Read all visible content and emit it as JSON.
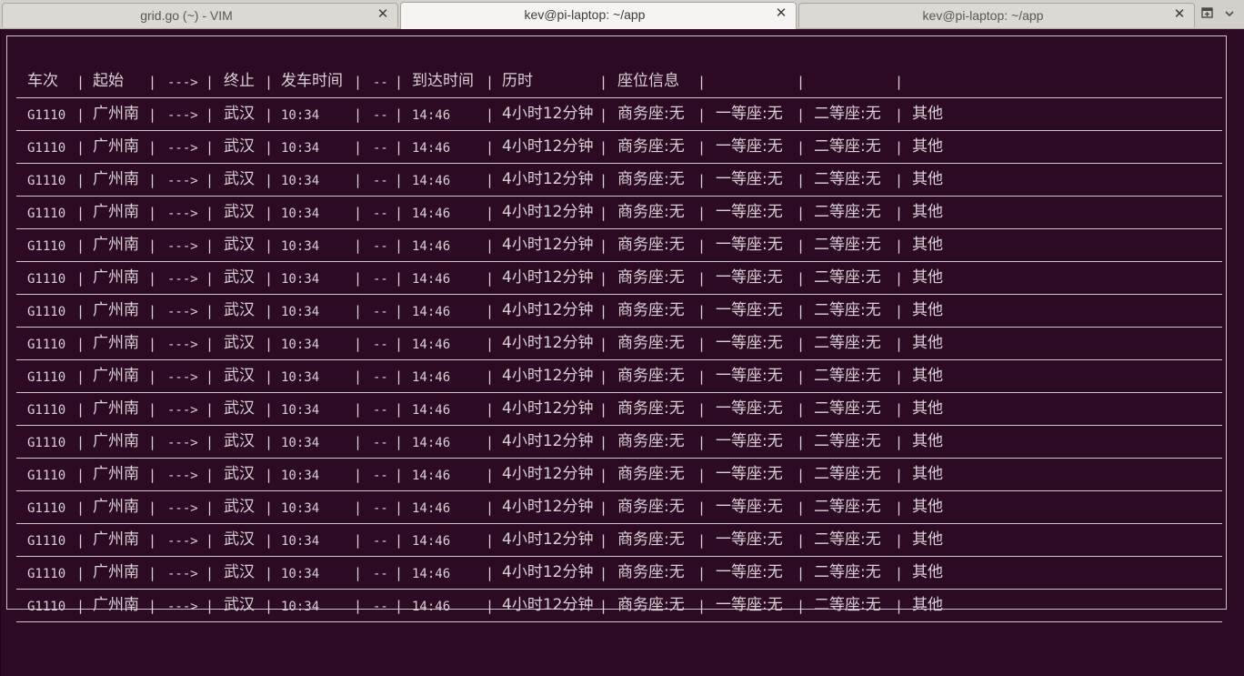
{
  "tabs": [
    {
      "title": "grid.go (~) - VIM",
      "active": false
    },
    {
      "title": "kev@pi-laptop: ~/app",
      "active": true
    },
    {
      "title": "kev@pi-laptop: ~/app",
      "active": false
    }
  ],
  "tab_close_glyph": "✕",
  "new_tab_icon": "new-tab-icon",
  "table": {
    "separator": "|",
    "header": {
      "train": "车次",
      "from": "起始",
      "arrow": "--->",
      "to": "终止",
      "depart": "发车时间",
      "dash": "--",
      "arrive": "到达时间",
      "duration": "历时",
      "seat_info": "座位信息",
      "c1": "",
      "c2": "",
      "c3": ""
    },
    "rows": [
      {
        "train": "G1110",
        "from": "广州南",
        "arrow": "--->",
        "to": "武汉",
        "depart": "10:34",
        "dash": "--",
        "arrive": "14:46",
        "duration": "4小时12分钟",
        "business": "商务座:无",
        "first": "一等座:无",
        "second": "二等座:无",
        "other": "其他"
      },
      {
        "train": "G1110",
        "from": "广州南",
        "arrow": "--->",
        "to": "武汉",
        "depart": "10:34",
        "dash": "--",
        "arrive": "14:46",
        "duration": "4小时12分钟",
        "business": "商务座:无",
        "first": "一等座:无",
        "second": "二等座:无",
        "other": "其他"
      },
      {
        "train": "G1110",
        "from": "广州南",
        "arrow": "--->",
        "to": "武汉",
        "depart": "10:34",
        "dash": "--",
        "arrive": "14:46",
        "duration": "4小时12分钟",
        "business": "商务座:无",
        "first": "一等座:无",
        "second": "二等座:无",
        "other": "其他"
      },
      {
        "train": "G1110",
        "from": "广州南",
        "arrow": "--->",
        "to": "武汉",
        "depart": "10:34",
        "dash": "--",
        "arrive": "14:46",
        "duration": "4小时12分钟",
        "business": "商务座:无",
        "first": "一等座:无",
        "second": "二等座:无",
        "other": "其他"
      },
      {
        "train": "G1110",
        "from": "广州南",
        "arrow": "--->",
        "to": "武汉",
        "depart": "10:34",
        "dash": "--",
        "arrive": "14:46",
        "duration": "4小时12分钟",
        "business": "商务座:无",
        "first": "一等座:无",
        "second": "二等座:无",
        "other": "其他"
      },
      {
        "train": "G1110",
        "from": "广州南",
        "arrow": "--->",
        "to": "武汉",
        "depart": "10:34",
        "dash": "--",
        "arrive": "14:46",
        "duration": "4小时12分钟",
        "business": "商务座:无",
        "first": "一等座:无",
        "second": "二等座:无",
        "other": "其他"
      },
      {
        "train": "G1110",
        "from": "广州南",
        "arrow": "--->",
        "to": "武汉",
        "depart": "10:34",
        "dash": "--",
        "arrive": "14:46",
        "duration": "4小时12分钟",
        "business": "商务座:无",
        "first": "一等座:无",
        "second": "二等座:无",
        "other": "其他"
      },
      {
        "train": "G1110",
        "from": "广州南",
        "arrow": "--->",
        "to": "武汉",
        "depart": "10:34",
        "dash": "--",
        "arrive": "14:46",
        "duration": "4小时12分钟",
        "business": "商务座:无",
        "first": "一等座:无",
        "second": "二等座:无",
        "other": "其他"
      },
      {
        "train": "G1110",
        "from": "广州南",
        "arrow": "--->",
        "to": "武汉",
        "depart": "10:34",
        "dash": "--",
        "arrive": "14:46",
        "duration": "4小时12分钟",
        "business": "商务座:无",
        "first": "一等座:无",
        "second": "二等座:无",
        "other": "其他"
      },
      {
        "train": "G1110",
        "from": "广州南",
        "arrow": "--->",
        "to": "武汉",
        "depart": "10:34",
        "dash": "--",
        "arrive": "14:46",
        "duration": "4小时12分钟",
        "business": "商务座:无",
        "first": "一等座:无",
        "second": "二等座:无",
        "other": "其他"
      },
      {
        "train": "G1110",
        "from": "广州南",
        "arrow": "--->",
        "to": "武汉",
        "depart": "10:34",
        "dash": "--",
        "arrive": "14:46",
        "duration": "4小时12分钟",
        "business": "商务座:无",
        "first": "一等座:无",
        "second": "二等座:无",
        "other": "其他"
      },
      {
        "train": "G1110",
        "from": "广州南",
        "arrow": "--->",
        "to": "武汉",
        "depart": "10:34",
        "dash": "--",
        "arrive": "14:46",
        "duration": "4小时12分钟",
        "business": "商务座:无",
        "first": "一等座:无",
        "second": "二等座:无",
        "other": "其他"
      },
      {
        "train": "G1110",
        "from": "广州南",
        "arrow": "--->",
        "to": "武汉",
        "depart": "10:34",
        "dash": "--",
        "arrive": "14:46",
        "duration": "4小时12分钟",
        "business": "商务座:无",
        "first": "一等座:无",
        "second": "二等座:无",
        "other": "其他"
      },
      {
        "train": "G1110",
        "from": "广州南",
        "arrow": "--->",
        "to": "武汉",
        "depart": "10:34",
        "dash": "--",
        "arrive": "14:46",
        "duration": "4小时12分钟",
        "business": "商务座:无",
        "first": "一等座:无",
        "second": "二等座:无",
        "other": "其他"
      },
      {
        "train": "G1110",
        "from": "广州南",
        "arrow": "--->",
        "to": "武汉",
        "depart": "10:34",
        "dash": "--",
        "arrive": "14:46",
        "duration": "4小时12分钟",
        "business": "商务座:无",
        "first": "一等座:无",
        "second": "二等座:无",
        "other": "其他"
      },
      {
        "train": "G1110",
        "from": "广州南",
        "arrow": "--->",
        "to": "武汉",
        "depart": "10:34",
        "dash": "--",
        "arrive": "14:46",
        "duration": "4小时12分钟",
        "business": "商务座:无",
        "first": "一等座:无",
        "second": "二等座:无",
        "other": "其他"
      }
    ]
  }
}
